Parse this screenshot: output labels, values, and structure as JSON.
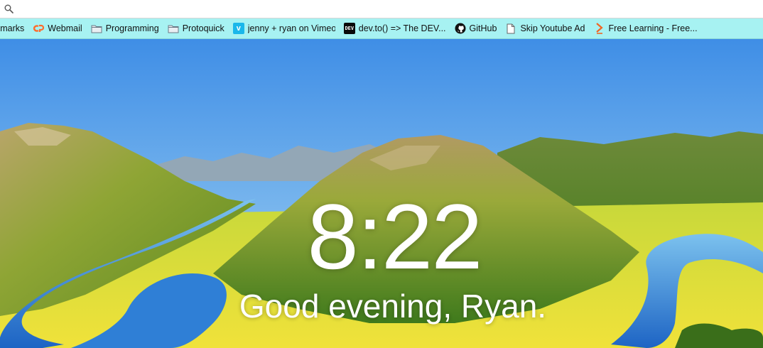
{
  "browser": {
    "address_value": "",
    "bookmarks": [
      {
        "label": "kmarks",
        "icon": "folder-icon"
      },
      {
        "label": "Webmail",
        "icon": "cpanel-icon"
      },
      {
        "label": "Programming",
        "icon": "folder-icon"
      },
      {
        "label": "Protoquick",
        "icon": "folder-icon"
      },
      {
        "label": "jenny + ryan on Vimeo",
        "icon": "vimeo-icon"
      },
      {
        "label": "dev.to() => The DEV...",
        "icon": "dev-icon"
      },
      {
        "label": "GitHub",
        "icon": "github-icon"
      },
      {
        "label": "Skip Youtube Ad",
        "icon": "page-icon"
      },
      {
        "label": "Free Learning - Free...",
        "icon": "packt-icon"
      }
    ]
  },
  "dashboard": {
    "time": "8:22",
    "greeting": "Good evening, Ryan."
  },
  "colors": {
    "bookmark_bar": "#a7f2f2",
    "sky": "#5a9fe0",
    "river": "#2f7fd6",
    "text": "#ffffff"
  }
}
